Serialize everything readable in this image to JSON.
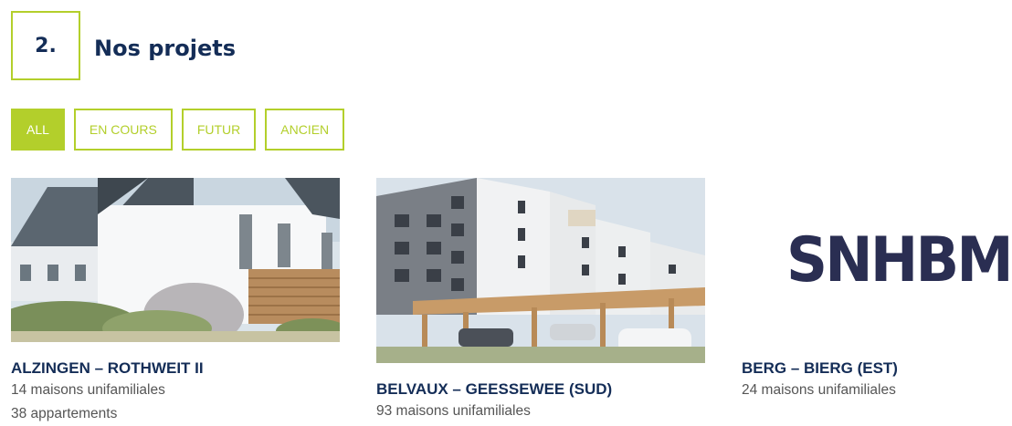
{
  "section": {
    "number": "2.",
    "title": "Nos projets"
  },
  "filters": [
    {
      "label": "ALL",
      "active": true
    },
    {
      "label": "EN COURS",
      "active": false
    },
    {
      "label": "FUTUR",
      "active": false
    },
    {
      "label": "ANCIEN",
      "active": false
    }
  ],
  "projects": [
    {
      "title": "ALZINGEN – ROTHWEIT II",
      "lines": [
        "14 maisons unifamiliales",
        "38 appartements"
      ]
    },
    {
      "title": "BELVAUX – GEESSEWEE (SUD)",
      "lines": [
        "93 maisons unifamiliales"
      ]
    },
    {
      "title": "BERG – BIERG (EST)",
      "lines": [
        "24 maisons unifamiliales"
      ],
      "logo": "SNHBM"
    }
  ],
  "colors": {
    "accent": "#b3cf2b",
    "navy": "#142d57",
    "text": "#555555"
  }
}
